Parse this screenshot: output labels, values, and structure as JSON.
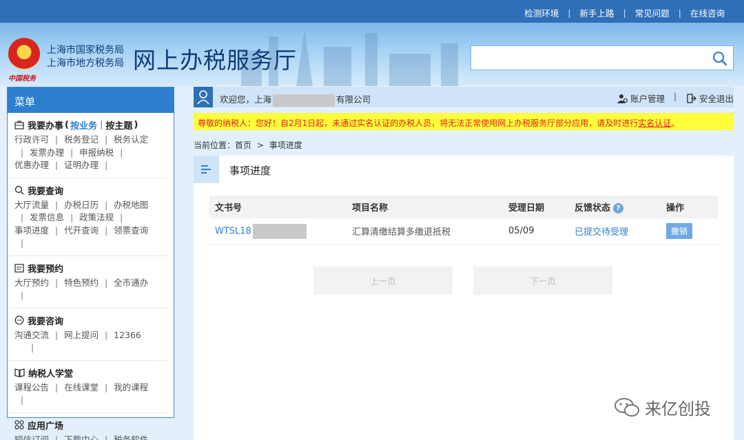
{
  "top_nav": {
    "links": [
      "检测环境",
      "新手上路",
      "常见问题",
      "在线咨询"
    ],
    "separator": "|"
  },
  "header": {
    "bureau_line1": "上海市国家税务局",
    "bureau_line2": "上海市地方税务局",
    "brand_title": "网上办税服务厅",
    "slogan": "中国税务",
    "search": {
      "placeholder": "",
      "value": "",
      "icon": "search-icon"
    }
  },
  "menu": {
    "title": "菜单",
    "sections": [
      {
        "icon": "briefcase-icon",
        "title": "我要办事",
        "paren_open": "(",
        "tab_active": "按业务",
        "tab_sep": "|",
        "tab_other": "按主题",
        "paren_close": ")",
        "items": [
          "行政许可",
          "税务登记",
          "税务认定",
          "发票办理",
          "申报纳税",
          "优惠办理",
          "证明办理"
        ]
      },
      {
        "icon": "search-icon",
        "title": "我要查询",
        "items": [
          "大厅流量",
          "办税日历",
          "办税地图",
          "发票信息",
          "政策法规",
          "事项进度",
          "代开查询",
          "领票查询"
        ]
      },
      {
        "icon": "calendar-icon",
        "title": "我要预约",
        "items": [
          "大厅预约",
          "特色预约",
          "全市通办"
        ]
      },
      {
        "icon": "chat-icon",
        "title": "我要咨询",
        "items": [
          "沟通交流",
          "网上提问",
          "12366"
        ]
      },
      {
        "icon": "book-icon",
        "title": "纳税人学堂",
        "items": [
          "课程公告",
          "在线课堂",
          "我的课程"
        ]
      },
      {
        "icon": "apps-icon",
        "title": "应用广场",
        "items": [
          "短信订阅",
          "下载中心",
          "税务软件"
        ]
      }
    ]
  },
  "welcome": {
    "prefix": "欢迎您，上海",
    "suffix": "有限公司",
    "account_label": "账户管理",
    "separator": "|",
    "logout_label": "安全退出"
  },
  "notice": {
    "text": "尊敬的纳税人：您好！自2月1日起，未通过实名认证的办税人员，将无法正常使用网上办税服务厅部分应用，请及时进行",
    "link": "实名认证",
    "end": "。"
  },
  "breadcrumb": {
    "label": "当前位置：",
    "home": "首页",
    "arrow": ">",
    "current": "事项进度"
  },
  "panel": {
    "title": "事项进度",
    "columns": [
      "文书号",
      "项目名称",
      "受理日期",
      "反馈状态",
      "操作"
    ],
    "help_glyph": "?",
    "rows": [
      {
        "doc_no": "WTSL18",
        "project": "汇算清缴结算多缴退抵税",
        "date": "05/09",
        "status": "已提交待受理",
        "action": "撤销"
      }
    ],
    "prev_label": "上一页",
    "next_label": "下一页"
  },
  "watermark": {
    "text": "来亿创投"
  },
  "colors": {
    "topbar": "#2f6fb8",
    "menu_head": "#2f7fcf",
    "link": "#2f7fcf",
    "notice_bg": "#fffe3c",
    "notice_text": "#e02020"
  }
}
